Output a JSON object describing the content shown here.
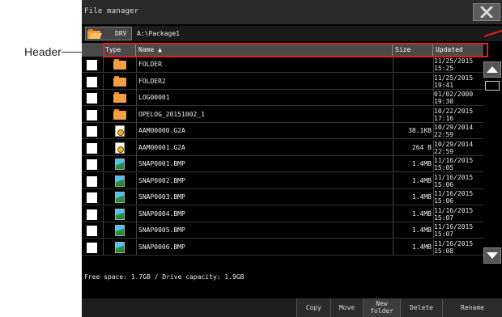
{
  "annotation": {
    "label": "Header",
    "frame_color": "#e02020"
  },
  "titlebar": {
    "title": "File manager",
    "close_icon": "close-icon"
  },
  "pathbar": {
    "drive_label": "DRV",
    "path": "A:\\Package1"
  },
  "columns": {
    "type": "Type",
    "name": "Name ▲",
    "size": "Size",
    "updated": "Updated"
  },
  "rows": [
    {
      "type": "folder",
      "name": "FOLDER",
      "size": "",
      "date": "11/25/2015",
      "time": "15:25"
    },
    {
      "type": "folder",
      "name": "FOLDER2",
      "size": "",
      "date": "11/25/2015",
      "time": "19:41"
    },
    {
      "type": "folder",
      "name": "LOG00001",
      "size": "",
      "date": "01/02/2000",
      "time": "19:30"
    },
    {
      "type": "folder",
      "name": "OPELOG_20151002_1",
      "size": "",
      "date": "10/22/2015",
      "time": "17:16"
    },
    {
      "type": "g2a",
      "name": "AAM00000.G2A",
      "size": "38.1KB",
      "date": "10/29/2014",
      "time": "22:59"
    },
    {
      "type": "g2a",
      "name": "AAM00001.G2A",
      "size": "264 B",
      "date": "10/29/2014",
      "time": "22:59"
    },
    {
      "type": "image",
      "name": "SNAP0001.BMP",
      "size": "1.4MB",
      "date": "11/16/2015",
      "time": "15:05"
    },
    {
      "type": "image",
      "name": "SNAP0002.BMP",
      "size": "1.4MB",
      "date": "11/16/2015",
      "time": "15:06"
    },
    {
      "type": "image",
      "name": "SNAP0003.BMP",
      "size": "1.4MB",
      "date": "11/16/2015",
      "time": "15:06"
    },
    {
      "type": "image",
      "name": "SNAP0004.BMP",
      "size": "1.4MB",
      "date": "11/16/2015",
      "time": "15:07"
    },
    {
      "type": "image",
      "name": "SNAP0005.BMP",
      "size": "1.4MB",
      "date": "11/16/2015",
      "time": "15:07"
    },
    {
      "type": "image",
      "name": "SNAP0006.BMP",
      "size": "1.4MB",
      "date": "11/16/2015",
      "time": "15:08"
    }
  ],
  "status": "Free space:  1.7GB / Drive capacity:  1.9GB",
  "buttons": {
    "copy": "Copy",
    "move": "Move",
    "new_folder_1": "New",
    "new_folder_2": "folder",
    "delete": "Delete",
    "rename": "Rename"
  },
  "colors": {
    "screen_bg": "#000000",
    "folder": "#f0a040",
    "header_bg": "#4a4a4a"
  }
}
